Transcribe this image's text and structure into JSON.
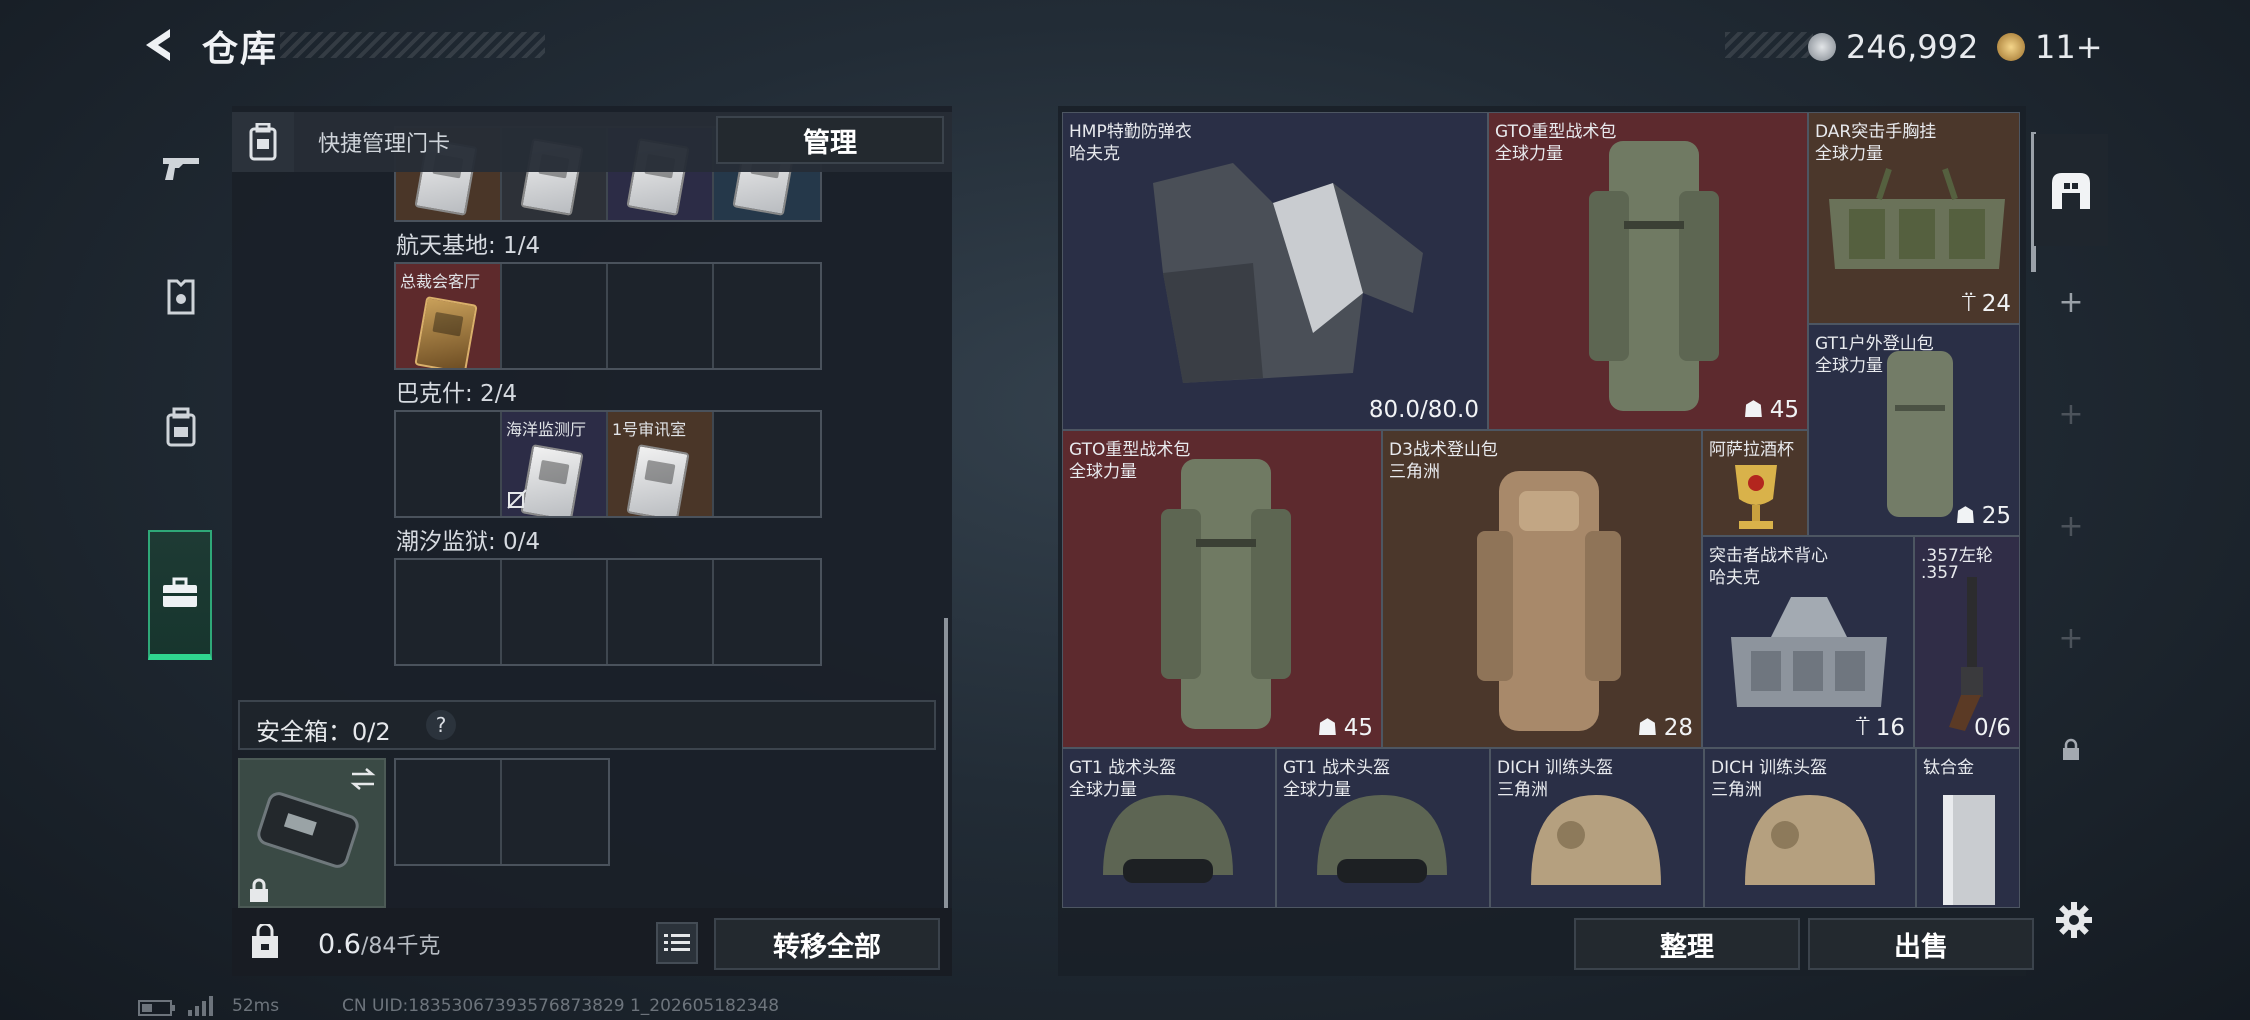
{
  "header": {
    "title": "仓库",
    "currency": [
      {
        "icon": "silver-coin-icon",
        "value": "246,992"
      },
      {
        "icon": "gold-coin-icon",
        "value": "11+"
      }
    ]
  },
  "left_tabs": [
    {
      "icon": "gun-icon"
    },
    {
      "icon": "armor-icon"
    },
    {
      "icon": "backpack-icon"
    },
    {
      "icon": "toolbox-icon",
      "active": true
    }
  ],
  "doorcards": {
    "label": "快捷管理门卡",
    "manage_label": "管理",
    "sections": [
      {
        "title": "航天基地: 1/4",
        "slots": [
          {
            "name": "总裁会客厅",
            "color": "red"
          },
          {
            "name": ""
          },
          {
            "name": ""
          },
          {
            "name": ""
          }
        ]
      },
      {
        "title": "巴克什: 2/4",
        "slots": [
          {
            "name": ""
          },
          {
            "name": "海洋监测厅",
            "color": "purple"
          },
          {
            "name": "1号审讯室",
            "color": "brown"
          },
          {
            "name": ""
          }
        ]
      },
      {
        "title": "潮汐监狱: 0/4",
        "slots": [
          {
            "name": ""
          },
          {
            "name": ""
          },
          {
            "name": ""
          },
          {
            "name": ""
          }
        ]
      }
    ]
  },
  "safebox": {
    "label": "安全箱：0/2",
    "help": "?"
  },
  "bottom_left": {
    "weight": "0.6",
    "weight_max": "/84千克",
    "transfer_all_label": "转移全部"
  },
  "items": [
    {
      "name": "HMP特勤防弹衣",
      "sub": "哈夫克",
      "qty": "80.0/80.0",
      "color": "navy"
    },
    {
      "name": "GTO重型战术包",
      "sub": "全球力量",
      "qty": "45",
      "color": "red"
    },
    {
      "name": "DAR突击手胸挂",
      "sub": "全球力量",
      "qty": "24",
      "color": "brown"
    },
    {
      "name": "GT1户外登山包",
      "sub": "全球力量",
      "qty": "25",
      "color": "navy"
    },
    {
      "name": "GTO重型战术包",
      "sub": "全球力量",
      "qty": "45",
      "color": "red"
    },
    {
      "name": "D3战术登山包",
      "sub": "三角洲",
      "qty": "28",
      "color": "brown"
    },
    {
      "name": "阿萨拉酒杯",
      "sub": "",
      "qty": "",
      "color": "brown"
    },
    {
      "name": "突击者战术背心",
      "sub": "哈夫克",
      "qty": "16",
      "color": "navy"
    },
    {
      "name": ".357左轮",
      ".sub": "",
      "sub": ".357",
      "qty": "0/6",
      "color": "purple"
    },
    {
      "name": "GT1 战术头盔",
      "sub": "全球力量",
      "qty": "",
      "color": "navy"
    },
    {
      "name": "GT1 战术头盔",
      "sub": "全球力量",
      "qty": "",
      "color": "navy"
    },
    {
      "name": "DICH 训练头盔",
      "sub": "三角洲",
      "qty": "",
      "color": "navy"
    },
    {
      "name": "DICH 训练头盔",
      "sub": "三角洲",
      "qty": "",
      "color": "navy"
    },
    {
      "name": "钛合金",
      "sub": "",
      "qty": "",
      "color": "navy"
    }
  ],
  "bottom_right": {
    "sort_label": "整理",
    "sell_label": "出售"
  },
  "footer": {
    "ping": "52ms",
    "uid": "CN UID:18353067393576873829 1_202605182348"
  }
}
